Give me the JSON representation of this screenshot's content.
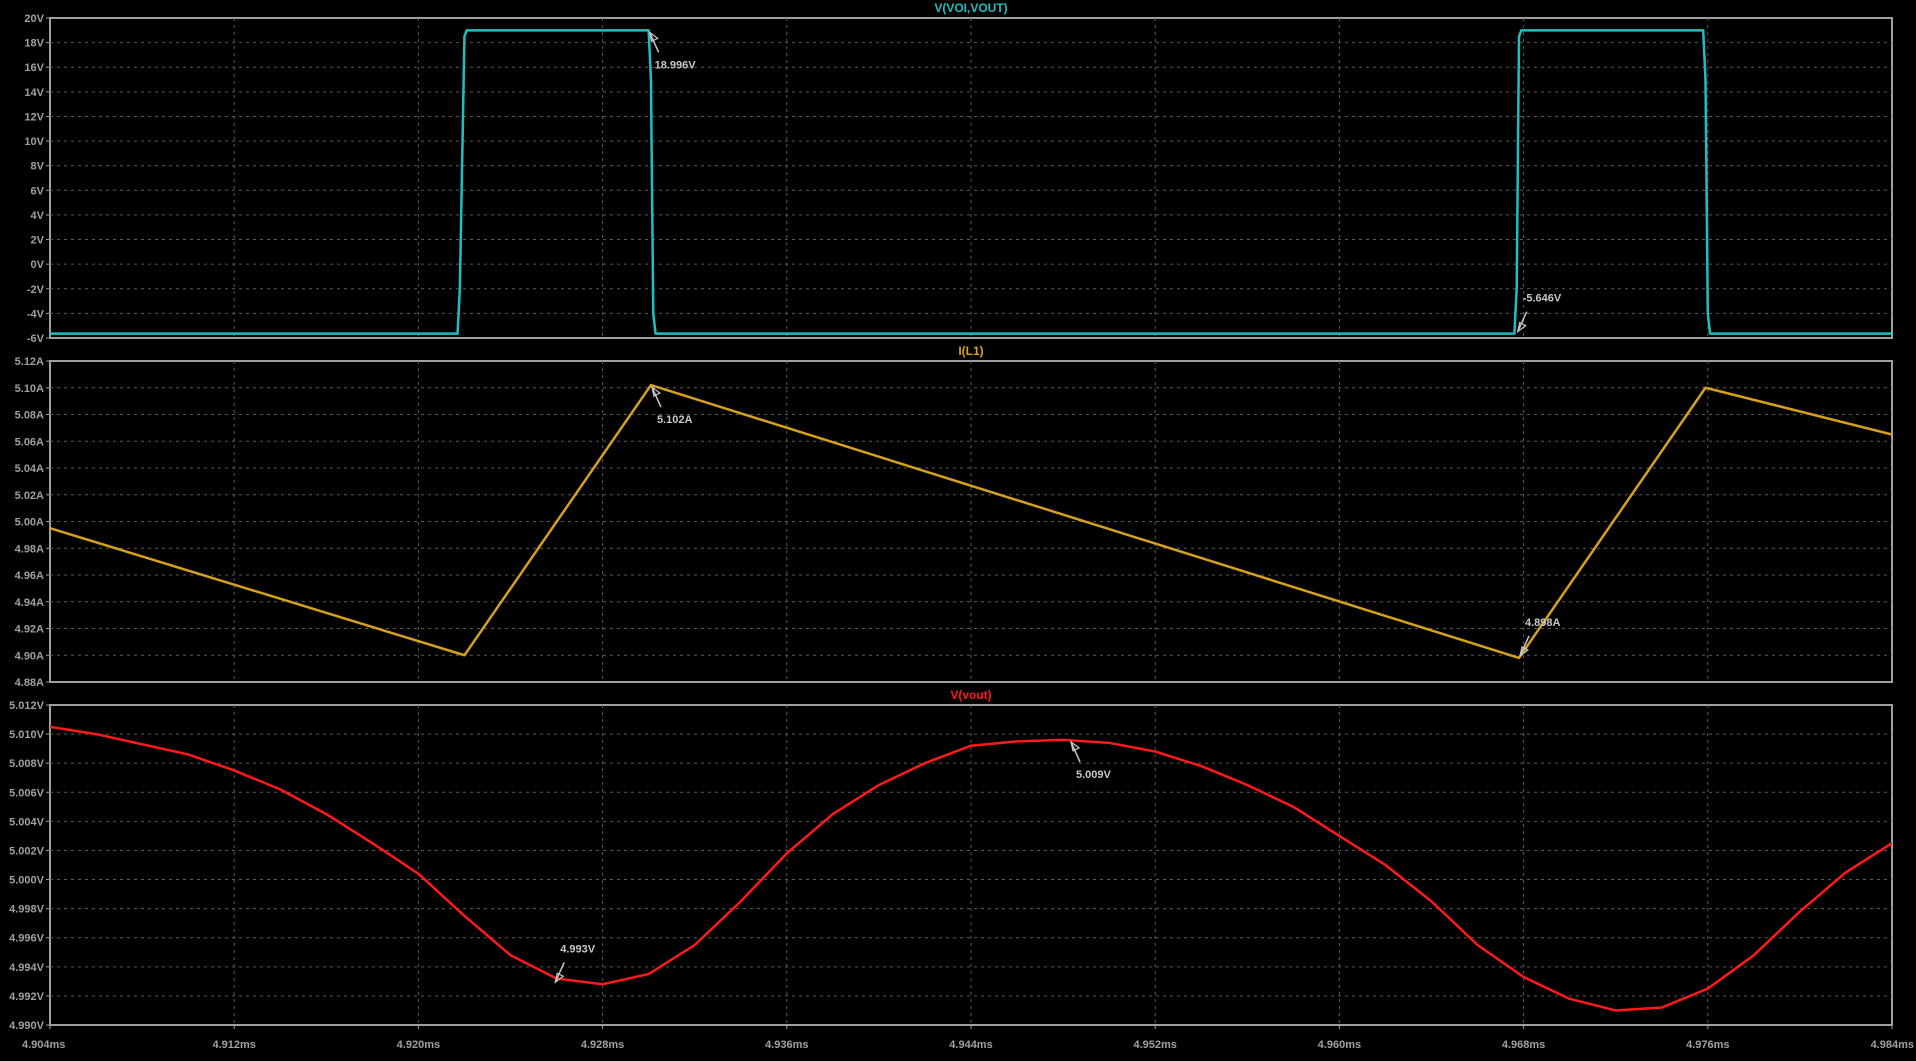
{
  "xaxis": {
    "ticks": [
      4.904,
      4.912,
      4.92,
      4.928,
      4.936,
      4.944,
      4.952,
      4.96,
      4.968,
      4.976,
      4.984
    ],
    "tick_labels": [
      "4.904ms",
      "4.912ms",
      "4.920ms",
      "4.928ms",
      "4.936ms",
      "4.944ms",
      "4.952ms",
      "4.960ms",
      "4.968ms",
      "4.976ms",
      "4.984ms"
    ],
    "xlim": [
      4.904,
      4.984
    ],
    "unit": "ms"
  },
  "colors": {
    "background": "#000000",
    "grid": "#5a5a5a",
    "frame": "#a0a0a0",
    "axis_text": "#a0a0a0",
    "cursor_label": "#c8c8c8"
  },
  "chart_data": [
    {
      "type": "line",
      "title": "V(VOI,VOUT)",
      "color": "#1fbfbf",
      "ylim": [
        -6,
        20
      ],
      "y_ticks": [
        20,
        18,
        16,
        14,
        12,
        10,
        8,
        6,
        4,
        2,
        0,
        -2,
        -4,
        -6
      ],
      "y_tick_labels": [
        "20V",
        "18V",
        "16V",
        "14V",
        "12V",
        "10V",
        "8V",
        "6V",
        "4V",
        "2V",
        "0V",
        "-2V",
        "-4V",
        "-6V"
      ],
      "series": [
        {
          "x": [
            4.904,
            4.9217,
            4.9218,
            4.922,
            4.9221,
            4.93,
            4.9301,
            4.9302,
            4.9303,
            4.9676,
            4.9677,
            4.9678,
            4.9679,
            4.9758,
            4.9759,
            4.976,
            4.9761,
            4.984
          ],
          "y": [
            -5.646,
            -5.646,
            -2.0,
            18.5,
            18.996,
            18.996,
            15.0,
            -4.0,
            -5.646,
            -5.646,
            -2.0,
            18.5,
            18.996,
            18.996,
            15.0,
            -4.0,
            -5.646,
            -5.646
          ]
        }
      ],
      "annotations": [
        {
          "x": 4.93,
          "y": 18.996,
          "text": "18.996V"
        },
        {
          "x": 4.9677,
          "y": -5.646,
          "text": "-5.646V"
        }
      ]
    },
    {
      "type": "line",
      "title": "I(L1)",
      "color": "#d4a01e",
      "ylim": [
        4.88,
        5.12
      ],
      "y_ticks": [
        5.12,
        5.1,
        5.08,
        5.06,
        5.04,
        5.02,
        5.0,
        4.98,
        4.96,
        4.94,
        4.92,
        4.9,
        4.88
      ],
      "y_tick_labels": [
        "5.12A",
        "5.10A",
        "5.08A",
        "5.06A",
        "5.04A",
        "5.02A",
        "5.00A",
        "4.98A",
        "4.96A",
        "4.94A",
        "4.92A",
        "4.90A",
        "4.88A"
      ],
      "series": [
        {
          "x": [
            4.904,
            4.922,
            4.9301,
            4.9678,
            4.9759,
            4.984
          ],
          "y": [
            4.995,
            4.9,
            5.102,
            4.898,
            5.1,
            5.065
          ]
        }
      ],
      "annotations": [
        {
          "x": 4.9301,
          "y": 5.102,
          "text": "5.102A"
        },
        {
          "x": 4.9678,
          "y": 4.898,
          "text": "4.898A"
        }
      ]
    },
    {
      "type": "line",
      "title": "V(vout)",
      "color": "#ff1a1a",
      "ylim": [
        4.99,
        5.012
      ],
      "y_ticks": [
        5.012,
        5.01,
        5.008,
        5.006,
        5.004,
        5.002,
        5.0,
        4.998,
        4.996,
        4.994,
        4.992,
        4.99
      ],
      "y_tick_labels": [
        "5.012V",
        "5.010V",
        "5.008V",
        "5.006V",
        "5.004V",
        "5.002V",
        "5.000V",
        "4.998V",
        "4.996V",
        "4.994V",
        "4.992V",
        "4.990V"
      ],
      "series": [
        {
          "x": [
            4.904,
            4.906,
            4.908,
            4.91,
            4.912,
            4.914,
            4.916,
            4.918,
            4.92,
            4.922,
            4.924,
            4.926,
            4.928,
            4.93,
            4.932,
            4.934,
            4.936,
            4.938,
            4.94,
            4.942,
            4.944,
            4.946,
            4.948,
            4.95,
            4.952,
            4.954,
            4.956,
            4.958,
            4.96,
            4.962,
            4.964,
            4.966,
            4.968,
            4.97,
            4.972,
            4.974,
            4.976,
            4.978,
            4.98,
            4.982,
            4.984
          ],
          "y": [
            5.0105,
            5.01,
            5.0093,
            5.0086,
            5.0075,
            5.0062,
            5.0045,
            5.0025,
            5.0004,
            4.9975,
            4.9948,
            4.9932,
            4.9928,
            4.9935,
            4.9955,
            4.9985,
            5.0018,
            5.0045,
            5.0065,
            5.008,
            5.0092,
            5.0095,
            5.0096,
            5.0094,
            5.0088,
            5.0078,
            5.0065,
            5.005,
            5.003,
            5.001,
            4.9985,
            4.9955,
            4.9933,
            4.9918,
            4.991,
            4.9912,
            4.9925,
            4.9948,
            4.9978,
            5.0005,
            5.0025
          ]
        }
      ],
      "annotations": [
        {
          "x": 4.9259,
          "y": 4.9928,
          "text": "4.993V"
        },
        {
          "x": 4.9483,
          "y": 5.0096,
          "text": "5.009V"
        }
      ]
    }
  ]
}
